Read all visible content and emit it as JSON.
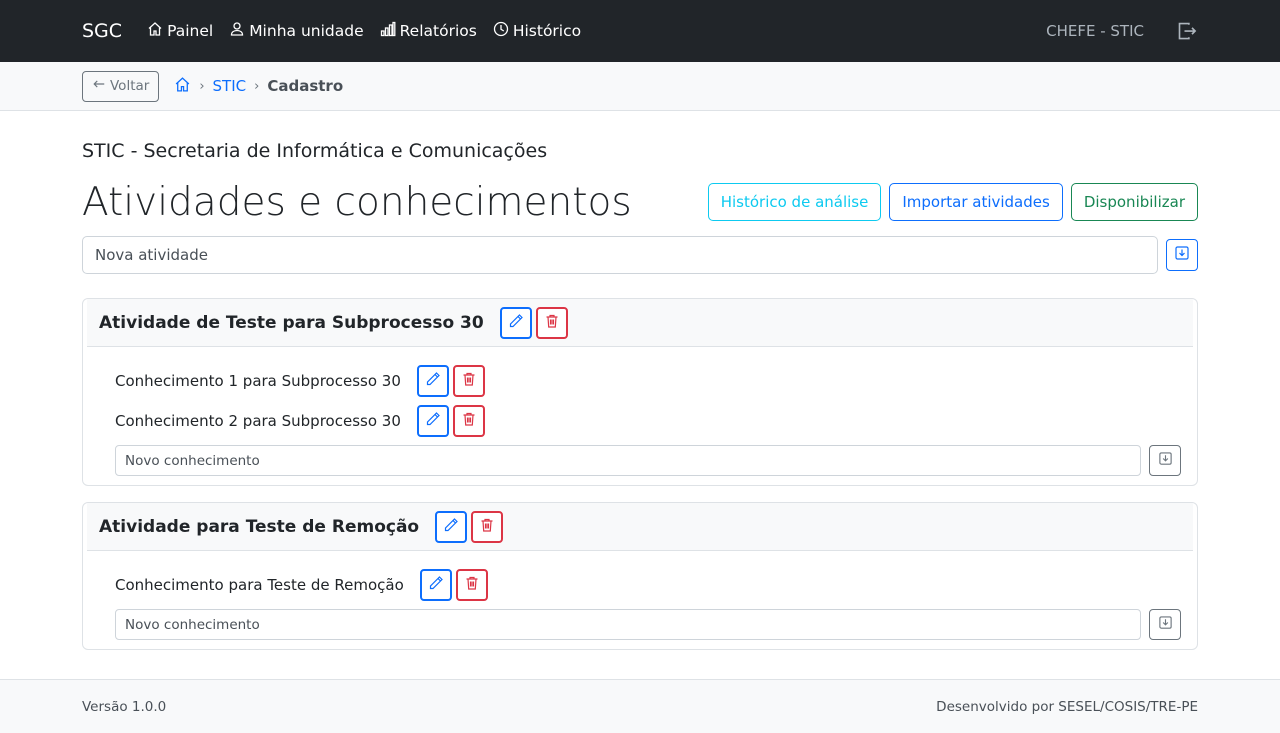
{
  "navbar": {
    "brand": "SGC",
    "links": [
      {
        "label": "Painel",
        "icon": "house-icon"
      },
      {
        "label": "Minha unidade",
        "icon": "person-icon"
      },
      {
        "label": "Relatórios",
        "icon": "bar-chart-icon"
      },
      {
        "label": "Histórico",
        "icon": "clock-icon"
      }
    ],
    "user": "CHEFE - STIC",
    "logout_icon": "box-arrow-right-icon"
  },
  "breadcrumb": {
    "back_label": "Voltar",
    "items": [
      "STIC",
      "Cadastro"
    ]
  },
  "main": {
    "unit_name": "STIC - Secretaria de Informática e Comunicações",
    "title": "Atividades e conhecimentos",
    "actions": {
      "history": "Histórico de análise",
      "import": "Importar atividades",
      "publish": "Disponibilizar"
    },
    "new_activity_placeholder": "Nova atividade",
    "activities": [
      {
        "title": "Atividade de Teste para Subprocesso 30",
        "knowledge": [
          "Conhecimento 1 para Subprocesso 30",
          "Conhecimento 2 para Subprocesso 30"
        ],
        "new_knowledge_placeholder": "Novo conhecimento"
      },
      {
        "title": "Atividade para Teste de Remoção",
        "knowledge": [
          "Conhecimento para Teste de Remoção"
        ],
        "new_knowledge_placeholder": "Novo conhecimento"
      }
    ]
  },
  "footer": {
    "version": "Versão 1.0.0",
    "credits": "Desenvolvido por SESEL/COSIS/TRE-PE"
  },
  "colors": {
    "navbar_bg": "#212529",
    "primary": "#0d6efd",
    "danger": "#dc3545",
    "info": "#0dcaf0",
    "success": "#198754"
  }
}
